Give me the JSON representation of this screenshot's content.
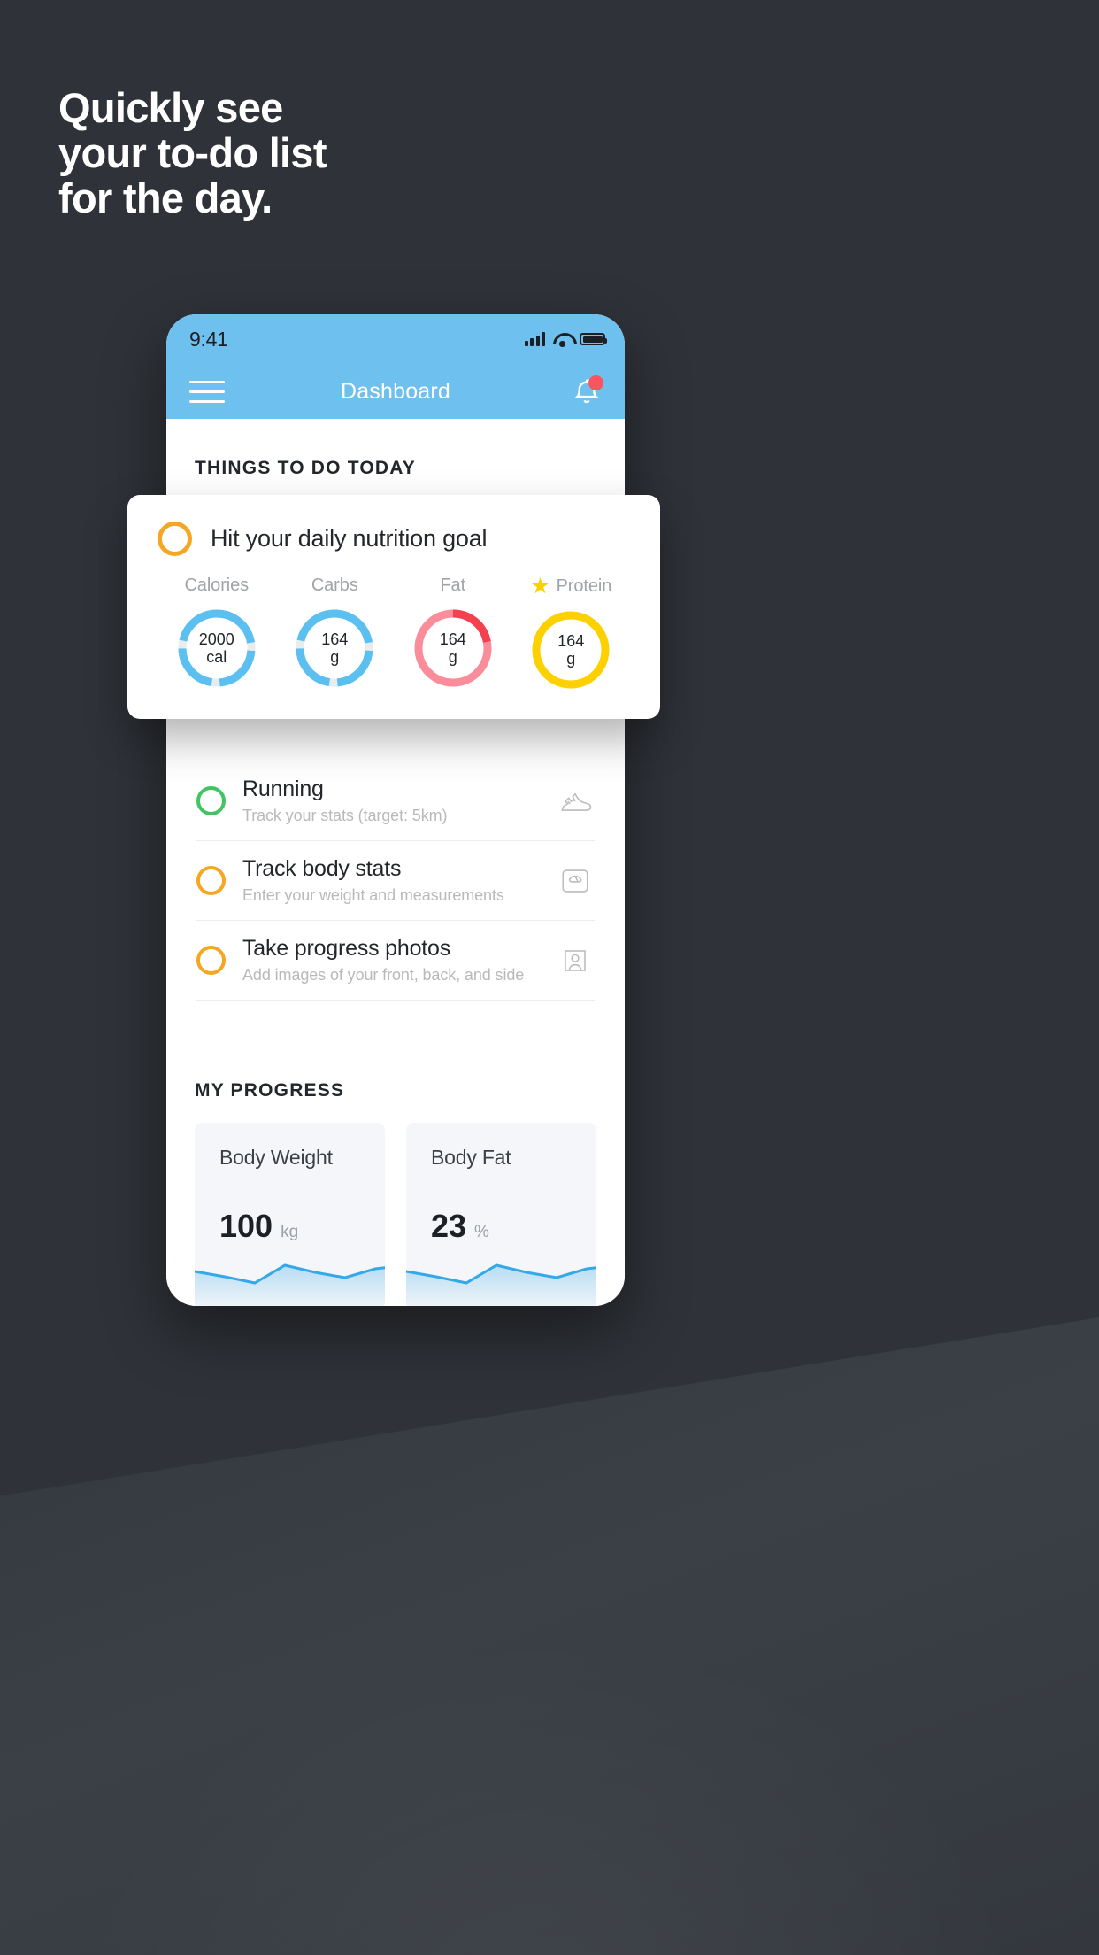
{
  "headline": {
    "line1": "Quickly see",
    "line2": "your to-do list",
    "line3": "for the day."
  },
  "colors": {
    "background": "#2f3238",
    "accent_blue": "#6ec1ee",
    "amber": "#f5a623",
    "yellow": "#fdd000",
    "green": "#43c463",
    "pink": "#fb8c9a",
    "red": "#f9545f",
    "sparkline": "#35a8e8"
  },
  "phone": {
    "status_bar": {
      "time": "9:41",
      "signal_icon": "cellular-signal-icon",
      "wifi_icon": "wifi-icon",
      "battery_icon": "battery-icon"
    },
    "app_bar": {
      "menu_icon": "hamburger-menu-icon",
      "title": "Dashboard",
      "bell_icon": "notification-bell-icon",
      "badge_icon": "notification-badge-dot"
    },
    "things_to_do": {
      "section_title": "THINGS TO DO TODAY",
      "items": [
        {
          "title": "Running",
          "subtitle": "Track your stats (target: 5km)",
          "ring_color": "#43c463",
          "icon": "running-shoe-icon"
        },
        {
          "title": "Track body stats",
          "subtitle": "Enter your weight and measurements",
          "ring_color": "#f5a623",
          "icon": "weighing-scale-icon"
        },
        {
          "title": "Take progress photos",
          "subtitle": "Add images of your front, back, and side",
          "ring_color": "#f5a623",
          "icon": "person-photo-icon"
        }
      ]
    },
    "my_progress": {
      "section_title": "MY PROGRESS",
      "cards": [
        {
          "label": "Body Weight",
          "value": "100",
          "unit": "kg"
        },
        {
          "label": "Body Fat",
          "value": "23",
          "unit": "%"
        }
      ]
    }
  },
  "nutrition_card": {
    "ring_color": "#f5a623",
    "title": "Hit your daily nutrition goal",
    "macros": [
      {
        "label": "Calories",
        "value": "2000",
        "unit": "cal",
        "color": "#5bc0f0",
        "track": "#e7ecef",
        "starred": false,
        "percent": 86
      },
      {
        "label": "Carbs",
        "value": "164",
        "unit": "g",
        "color": "#5bc0f0",
        "track": "#e7ecef",
        "starred": false,
        "percent": 86
      },
      {
        "label": "Fat",
        "value": "164",
        "unit": "g",
        "color": "#fb8c9a",
        "track": "#fb8c9a",
        "starred": false,
        "percent": 22
      },
      {
        "label": "Protein",
        "value": "164",
        "unit": "g",
        "color": "#fdd000",
        "track": "#fdd000",
        "starred": true,
        "percent": 100
      }
    ],
    "star_icon": "star-icon",
    "star_glyph": "★"
  },
  "chart_data": [
    {
      "type": "line",
      "title": "Body Weight",
      "ylabel": "kg",
      "x": [
        0,
        1,
        2,
        3,
        4,
        5,
        6
      ],
      "values": [
        46,
        38,
        30,
        56,
        48,
        38,
        52,
        58
      ],
      "latest": 100,
      "grid": false,
      "legend": "none"
    },
    {
      "type": "line",
      "title": "Body Fat",
      "ylabel": "%",
      "x": [
        0,
        1,
        2,
        3,
        4,
        5,
        6
      ],
      "values": [
        46,
        38,
        30,
        56,
        48,
        38,
        52,
        58
      ],
      "latest": 23,
      "grid": false,
      "legend": "none"
    }
  ]
}
